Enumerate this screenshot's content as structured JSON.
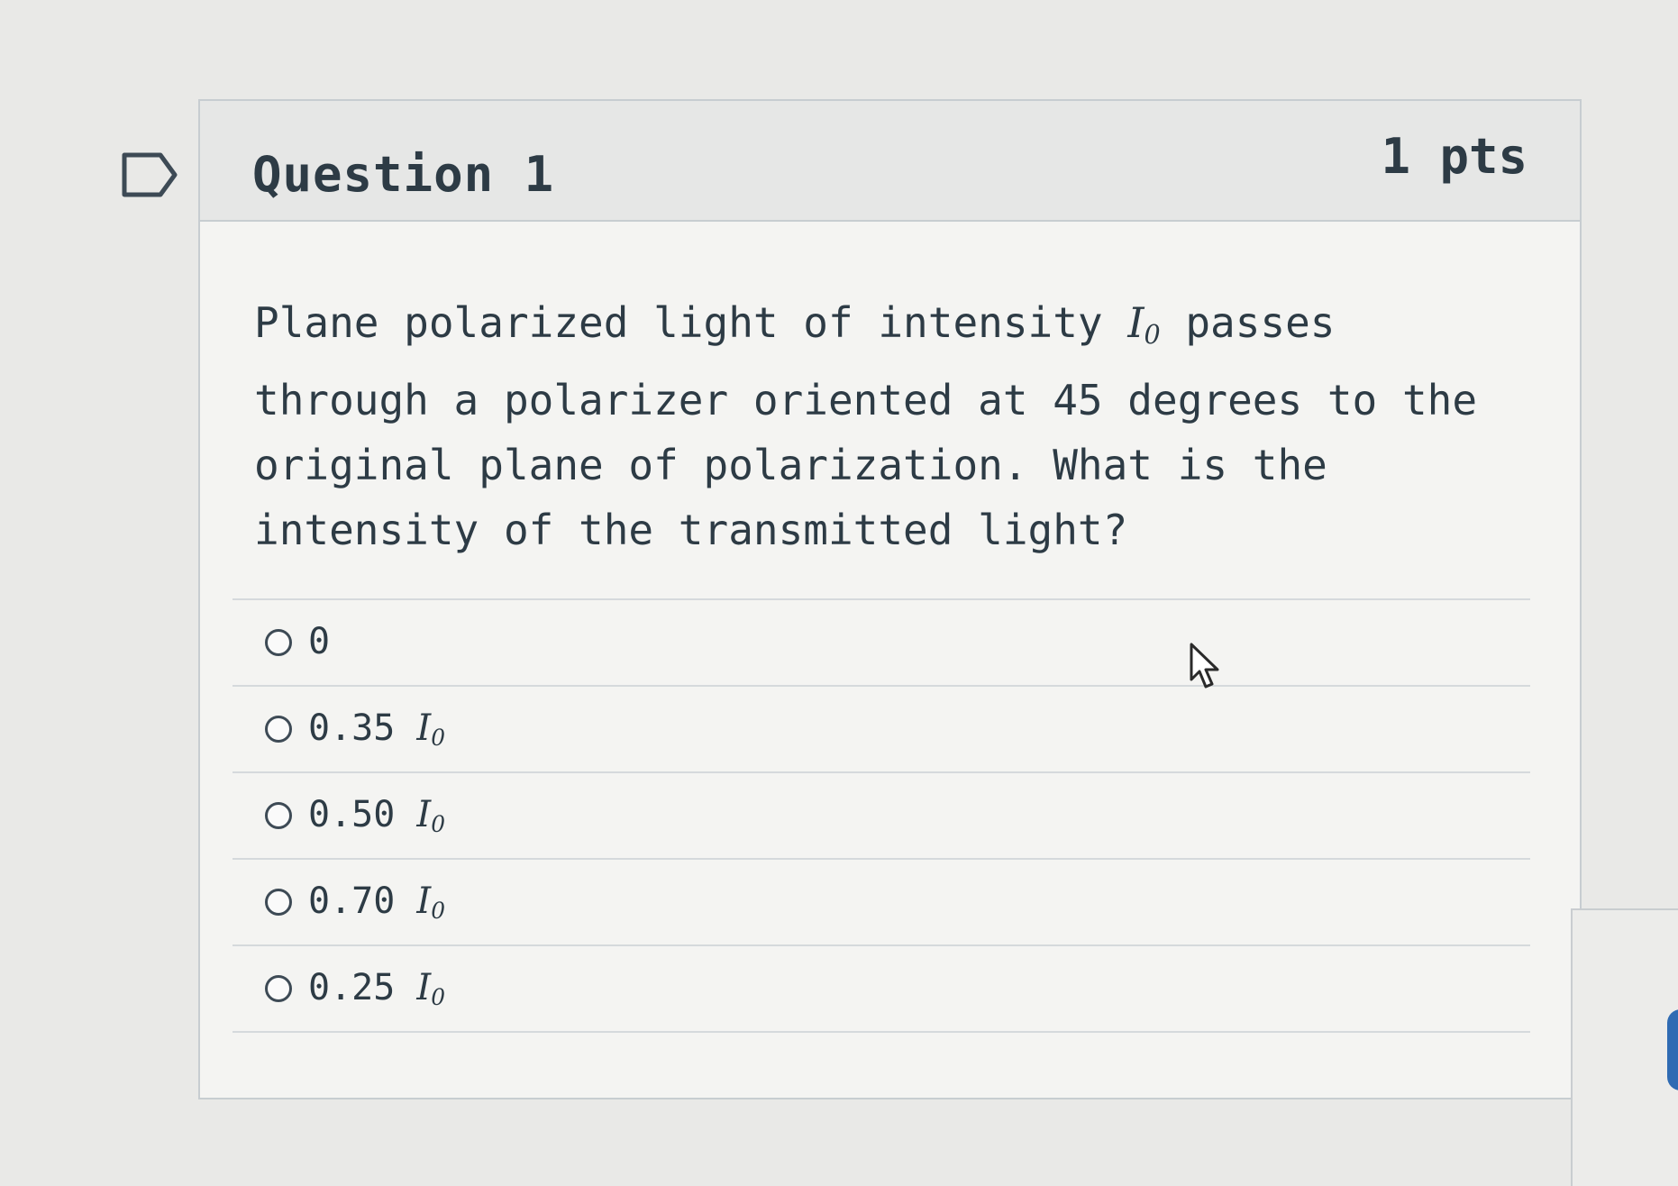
{
  "question": {
    "title": "Question 1",
    "points": "1 pts",
    "text_before_var": "Plane polarized light of intensity ",
    "var_base": "I",
    "var_sub": "0",
    "text_after_var": " passes through a polarizer oriented at 45 degrees to the original plane of polarization. What is the intensity of the transmitted light?"
  },
  "answers": [
    {
      "value": "0",
      "var_base": "",
      "var_sub": ""
    },
    {
      "value": "0.35 ",
      "var_base": "I",
      "var_sub": "0"
    },
    {
      "value": "0.50 ",
      "var_base": "I",
      "var_sub": "0"
    },
    {
      "value": "0.70 ",
      "var_base": "I",
      "var_sub": "0"
    },
    {
      "value": "0.25 ",
      "var_base": "I",
      "var_sub": "0"
    }
  ],
  "icons": {
    "flag": "flag-icon",
    "cursor": "mouse-pointer-icon",
    "radio": "radio-unselected-icon"
  },
  "colors": {
    "text": "#2d3b45",
    "border": "#c7cdd1",
    "header_bg": "#e6e7e6",
    "accent": "#2f6bb3"
  }
}
